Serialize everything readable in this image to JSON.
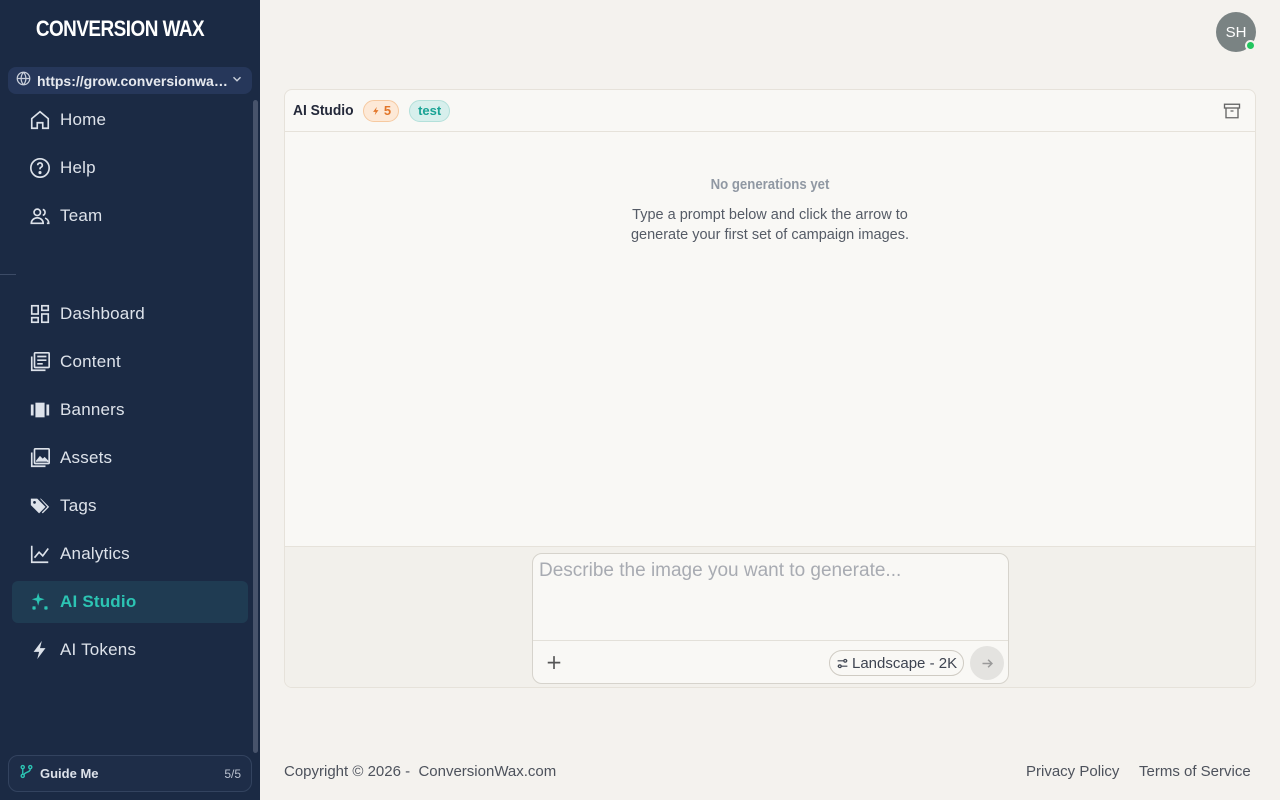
{
  "brand": {
    "logo_text": "CONVERSION WAX"
  },
  "site_selector": {
    "url": "https://grow.conversionwax.com",
    "icon": "globe-icon"
  },
  "sidebar": {
    "top_items": [
      {
        "label": "Home",
        "icon": "home-icon"
      },
      {
        "label": "Help",
        "icon": "help-circle-icon"
      },
      {
        "label": "Team",
        "icon": "users-icon"
      }
    ],
    "items": [
      {
        "label": "Dashboard",
        "icon": "dashboard-icon"
      },
      {
        "label": "Content",
        "icon": "content-icon"
      },
      {
        "label": "Banners",
        "icon": "banners-icon"
      },
      {
        "label": "Assets",
        "icon": "image-icon"
      },
      {
        "label": "Tags",
        "icon": "tags-icon"
      },
      {
        "label": "Analytics",
        "icon": "chart-line-icon"
      },
      {
        "label": "AI Studio",
        "icon": "sparkles-icon",
        "active": true
      },
      {
        "label": "AI Tokens",
        "icon": "bolt-icon"
      }
    ],
    "guide": {
      "label": "Guide Me",
      "progress": "5/5"
    }
  },
  "user": {
    "initials": "SH",
    "status": "online"
  },
  "studio": {
    "title": "AI Studio",
    "token_count": "5",
    "env_badge": "test",
    "empty_title": "No generations yet",
    "empty_description": "Type a prompt below and click the arrow to generate your first set of campaign images.",
    "prompt_placeholder": "Describe the image you want to generate...",
    "prompt_value": "",
    "size_option": "Landscape - 2K"
  },
  "footer": {
    "copyright": "Copyright © 2026 -  ConversionWax.com",
    "privacy": "Privacy Policy",
    "terms": "Terms of Service"
  },
  "colors": {
    "sidebar_bg": "#1b2a44",
    "accent": "#2cc4b3",
    "page_bg": "#f4f2ee",
    "token_orange": "#e2762a",
    "online_green": "#22c55e"
  }
}
